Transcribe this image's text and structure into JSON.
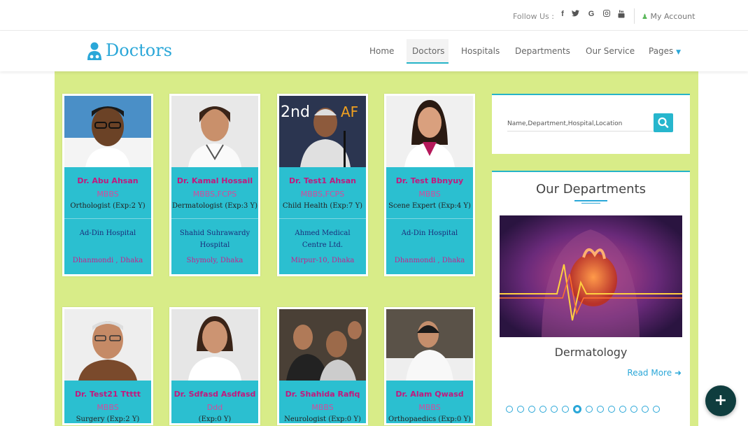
{
  "topbar": {
    "follow_label": "Follow Us :",
    "social_icons": [
      "facebook-icon",
      "twitter-icon",
      "google-icon",
      "instagram-icon",
      "youtube-icon"
    ],
    "social_glyphs": [
      "f",
      "•",
      "G",
      "◎",
      "▣"
    ],
    "account_label": "My Account"
  },
  "nav": {
    "logo_text": "Doctors",
    "items": [
      "Home",
      "Doctors",
      "Hospitals",
      "Departments",
      "Our Service",
      "Pages"
    ],
    "active": "Doctors"
  },
  "doctors": [
    {
      "name": "Dr. Abu Ahsan",
      "degree": "MBBS",
      "spec": "Orthologist (Exp:2 Y)",
      "hospital": "Ad-Din Hospital",
      "location": "Dhanmondi , Dhaka"
    },
    {
      "name": "Dr. Kamal Hossail",
      "degree": "MBBS,FCPS",
      "spec": "Dermatologist (Exp:3 Y)",
      "hospital": "Shahid Suhrawardy Hospital",
      "location": "Shymoly, Dhaka"
    },
    {
      "name": "Dr. Test1 Ahsan",
      "degree": "MBBS,FCPS",
      "spec": "Child Health (Exp:7 Y)",
      "hospital": "Ahmed Medical Centre Ltd.",
      "location": "Mirpur-10, Dhaka"
    },
    {
      "name": "Dr. Test Bbnyuy",
      "degree": "MBBS",
      "spec": "Scene Expert (Exp:4 Y)",
      "hospital": "Ad-Din Hospital",
      "location": "Dhanmondi , Dhaka"
    },
    {
      "name": "Dr. Test21 Ttttt",
      "degree": "MBBS",
      "spec": "Surgery (Exp:2 Y)"
    },
    {
      "name": "Dr. Sdfasd Asdfasd",
      "degree": "Ddd",
      "spec": "(Exp:0 Y)"
    },
    {
      "name": "Dr. Shahida Rafiq",
      "degree": "MBBS",
      "spec": "Neurologist (Exp:0 Y)"
    },
    {
      "name": "Dr. Alam Qwasd",
      "degree": "MBBS",
      "spec": "Orthopaedics (Exp:0 Y)"
    }
  ],
  "search": {
    "placeholder": "Name,Department,Hospital,Location"
  },
  "departments": {
    "title": "Our Departments",
    "current": "Dermatology",
    "read_more": "Read More",
    "dot_count": 14,
    "active_dot": 6
  },
  "fab_label": "+"
}
